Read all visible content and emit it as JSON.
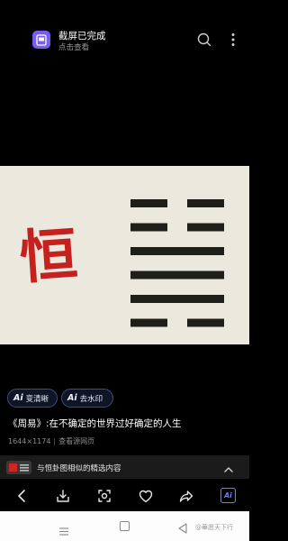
{
  "notification": {
    "title": "截屏已完成",
    "subtitle": "点击查看"
  },
  "hero": {
    "character": "恒",
    "character_color": "#c4211f",
    "background_color": "#ebe9dd",
    "hexagram_lines": [
      "yin",
      "yin",
      "yang",
      "yang",
      "yang",
      "yin"
    ]
  },
  "chips": {
    "clear": {
      "ai": "Ai",
      "label": "变清晰"
    },
    "watermark": {
      "ai": "Ai",
      "label": "去水印"
    }
  },
  "image_info": {
    "title": "《周易》:在不确定的世界过好确定的人生",
    "dimensions": "1644×1174",
    "separator": "|",
    "source_link": "查看源网页"
  },
  "related": {
    "label": "与恒卦图相似的精选内容"
  },
  "toolbar": {
    "ai_label": "Ai",
    "accent_color": "#5b8cff"
  },
  "watermark": "@華愿天下行"
}
